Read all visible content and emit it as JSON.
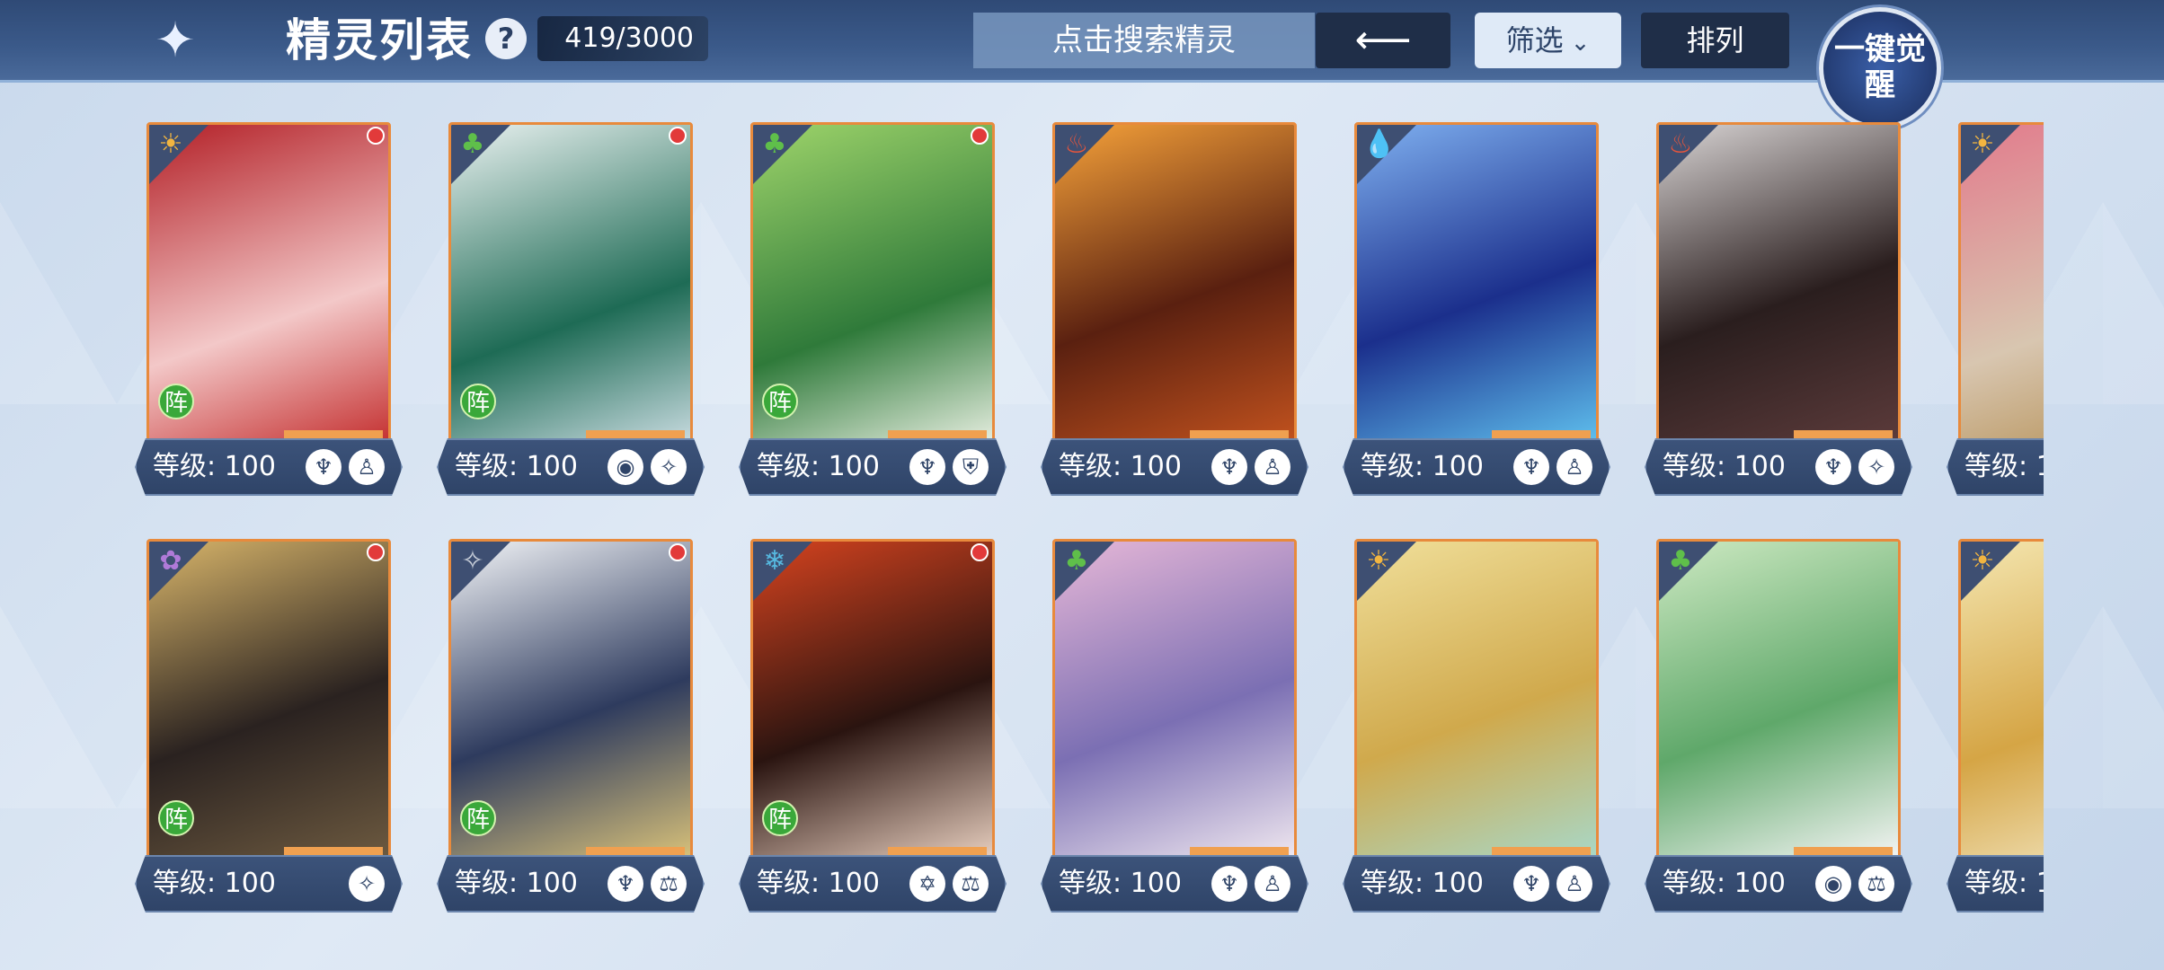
{
  "header": {
    "title": "精灵列表",
    "count": "419/3000",
    "search_placeholder": "点击搜索精灵",
    "filter_label": "筛选",
    "sort_label": "排列",
    "awaken_label": "一键觉醒"
  },
  "cards": [
    {
      "level": "等级: 100",
      "element": "light",
      "red_dot": true,
      "team": "阵"
    },
    {
      "level": "等级: 100",
      "element": "grass",
      "red_dot": true,
      "team": "阵"
    },
    {
      "level": "等级: 100",
      "element": "grass",
      "red_dot": true,
      "team": "阵"
    },
    {
      "level": "等级: 100",
      "element": "fire",
      "red_dot": false,
      "team": ""
    },
    {
      "level": "等级: 100",
      "element": "water",
      "red_dot": false,
      "team": ""
    },
    {
      "level": "等级: 100",
      "element": "fire",
      "red_dot": false,
      "team": ""
    },
    {
      "level": "等级: 1",
      "element": "light",
      "red_dot": false,
      "team": ""
    },
    {
      "level": "等级: 100",
      "element": "spirit",
      "red_dot": true,
      "team": "阵"
    },
    {
      "level": "等级: 100",
      "element": "metal",
      "red_dot": true,
      "team": "阵"
    },
    {
      "level": "等级: 100",
      "element": "ice",
      "red_dot": true,
      "team": "阵"
    },
    {
      "level": "等级: 100",
      "element": "grass",
      "red_dot": false,
      "team": ""
    },
    {
      "level": "等级: 100",
      "element": "light",
      "red_dot": false,
      "team": ""
    },
    {
      "level": "等级: 100",
      "element": "grass",
      "red_dot": false,
      "team": ""
    },
    {
      "level": "等级: 1",
      "element": "light",
      "red_dot": false,
      "team": ""
    }
  ],
  "colors": {
    "card_border": "#e88a3c",
    "header_bg": "#3b5a8a",
    "level_bar": "#3c537a",
    "red_dot": "#e23a3a",
    "team_badge": "#3aa83a"
  }
}
